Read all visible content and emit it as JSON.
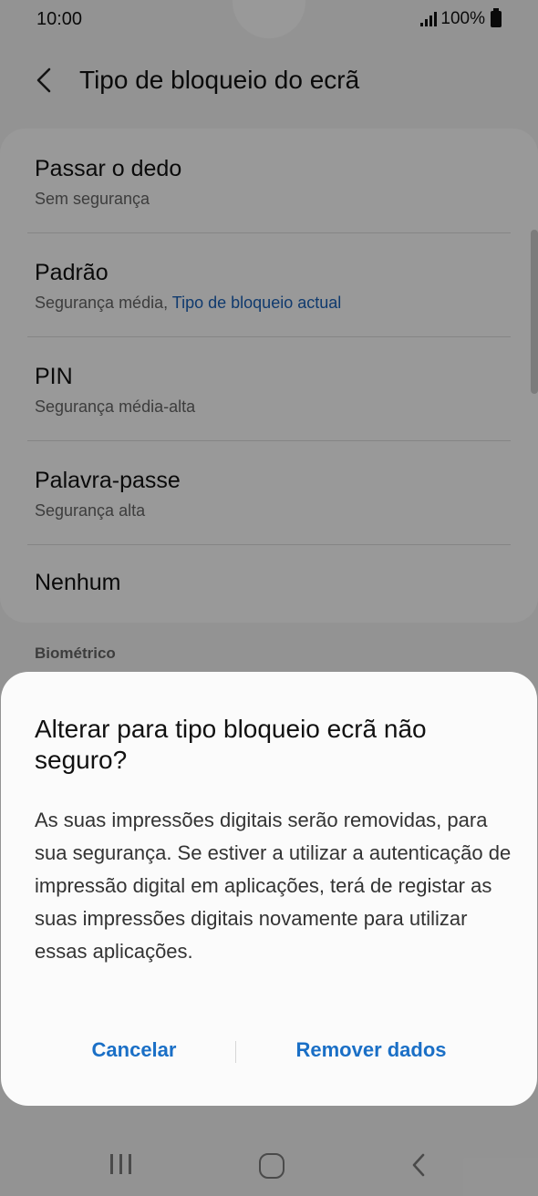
{
  "status_bar": {
    "time": "10:00",
    "battery_percent": "100%"
  },
  "header": {
    "title": "Tipo de bloqueio do ecrã"
  },
  "lock_options": [
    {
      "title": "Passar o dedo",
      "subtitle": "Sem segurança"
    },
    {
      "title": "Padrão",
      "subtitle": "Segurança média,",
      "subtitle_accent": "Tipo de bloqueio actual"
    },
    {
      "title": "PIN",
      "subtitle": "Segurança média-alta"
    },
    {
      "title": "Palavra-passe",
      "subtitle": "Segurança alta"
    },
    {
      "title": "Nenhum"
    }
  ],
  "section": {
    "biometrics_label": "Biométrico"
  },
  "dialog": {
    "title": "Alterar para tipo bloqueio ecrã não seguro?",
    "body": "As suas impressões digitais serão removidas, para sua segurança. Se estiver a utilizar a autenticação de impressão digital em aplicações, terá de registar as suas impressões digitais novamente para utilizar essas aplicações.",
    "cancel_label": "Cancelar",
    "confirm_label": "Remover dados"
  },
  "colors": {
    "accent": "#1a6fc6",
    "current_type": "#1a61b8"
  },
  "icons": {
    "back": "chevron-left-icon",
    "nav_recent": "recent-apps-icon",
    "nav_home": "home-icon",
    "nav_back": "back-icon"
  }
}
